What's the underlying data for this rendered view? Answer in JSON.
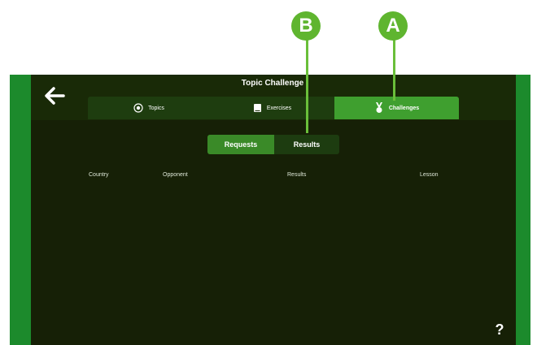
{
  "app": {
    "title": "Topic Challenge"
  },
  "tabs": [
    {
      "label": "Topics",
      "icon": "target-icon"
    },
    {
      "label": "Exercises",
      "icon": "book-icon"
    },
    {
      "label": "Challenges",
      "icon": "medal-icon",
      "active": true
    }
  ],
  "segmented": {
    "requests_label": "Requests",
    "results_label": "Results",
    "selected": "Requests"
  },
  "table": {
    "columns": [
      "Country",
      "Opponent",
      "Results",
      "Lesson"
    ]
  },
  "help": {
    "label": "?"
  },
  "callouts": {
    "a": "A",
    "b": "B"
  },
  "colors": {
    "frame": "#1c8a2c",
    "background": "#162006",
    "accent": "#3f9f2f",
    "callout": "#5fb52f"
  }
}
